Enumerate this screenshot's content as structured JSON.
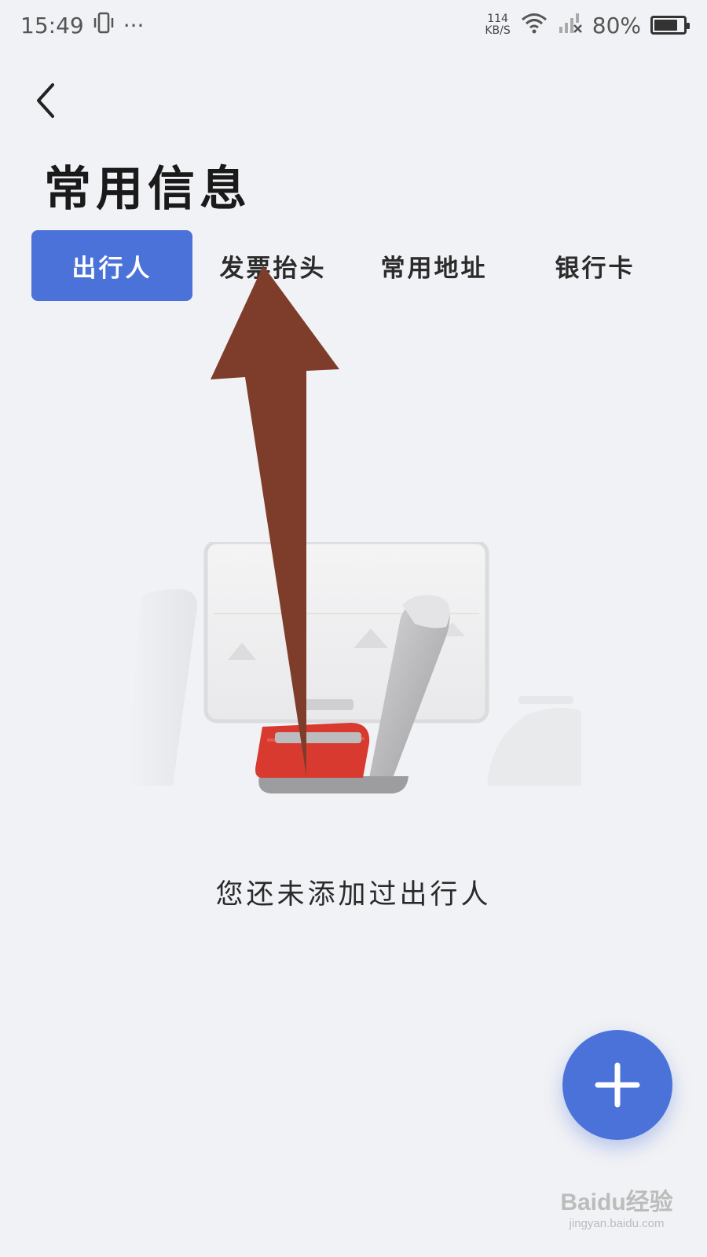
{
  "status_bar": {
    "time": "15:49",
    "dots": "···",
    "net_speed_value": "114",
    "net_speed_unit": "KB/S",
    "battery": "80%",
    "battery_level": 0.8
  },
  "header": {
    "title": "常用信息"
  },
  "tabs": [
    {
      "label": "出行人",
      "active": true
    },
    {
      "label": "发票抬头",
      "active": false
    },
    {
      "label": "常用地址",
      "active": false
    },
    {
      "label": "银行卡",
      "active": false
    }
  ],
  "empty_state": {
    "message": "您还未添加过出行人"
  },
  "watermark": {
    "logo": "Baidu经验",
    "url": "jingyan.baidu.com"
  },
  "colors": {
    "accent": "#4a72d9",
    "annotation_arrow": "#7e3d2b",
    "seat_red": "#d93a2f"
  }
}
